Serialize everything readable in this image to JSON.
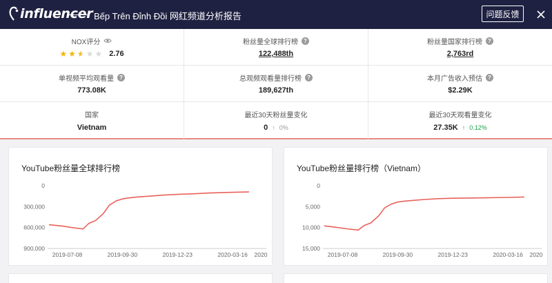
{
  "header": {
    "logo_text": "influencer",
    "title": "Bếp Trên Đỉnh Đồi 网红频道分析报告",
    "feedback_label": "问题反馈"
  },
  "stats": [
    [
      {
        "label": "NOX评分",
        "value": "2.76",
        "stars": 2.5,
        "icon": "eye-icon"
      },
      {
        "label": "粉丝量全球排行榜",
        "value": "122,488th",
        "link": true,
        "icon": "question-icon"
      },
      {
        "label": "粉丝量国家排行榜",
        "value": "2,763rd",
        "link": true,
        "icon": "question-icon"
      }
    ],
    [
      {
        "label": "单视频平均观看量",
        "value": "773.08K",
        "icon": "question-icon"
      },
      {
        "label": "总观频观看量排行榜",
        "value": "189,627th",
        "icon": "question-icon"
      },
      {
        "label": "本月广告收入预估",
        "value": "$2.29K",
        "icon": "question-icon"
      }
    ],
    [
      {
        "label": "国家",
        "value": "Vietnam"
      },
      {
        "label": "最近30天粉丝量变化",
        "value": "0",
        "arrow": "↑",
        "delta": "0%",
        "trend": "zero"
      },
      {
        "label": "最近30天观看量变化",
        "value": "27.35K",
        "arrow": "↑",
        "delta": "0.12%",
        "trend": "up"
      }
    ]
  ],
  "chart_data": [
    {
      "type": "line",
      "title": "YouTube粉丝量全球排行榜",
      "xlabel": "",
      "ylabel": "",
      "inverted_y": true,
      "ylim": [
        0,
        900000
      ],
      "yticks": [
        "0",
        "300,000",
        "600,000",
        "900,000"
      ],
      "xticks": [
        "2019-07-08",
        "2019-09-30",
        "2019-12-23",
        "2020-03-16",
        "2020"
      ],
      "line_color": "#e8625a",
      "series": [
        {
          "x": [
            "2019-06-10",
            "2019-07-01",
            "2019-07-15",
            "2019-08-01",
            "2019-08-10",
            "2019-08-20",
            "2019-09-01",
            "2019-09-10",
            "2019-09-20",
            "2019-09-30",
            "2019-10-10",
            "2019-10-25",
            "2019-11-10",
            "2019-12-01",
            "2019-12-23",
            "2020-01-15",
            "2020-02-10",
            "2020-03-16",
            "2020-04-10"
          ],
          "values": [
            560000,
            580000,
            600000,
            620000,
            540000,
            500000,
            400000,
            280000,
            220000,
            190000,
            175000,
            160000,
            150000,
            135000,
            125000,
            117000,
            105000,
            95000,
            90000
          ]
        }
      ]
    },
    {
      "type": "line",
      "title": "YouTube粉丝量排行榜（Vietnam）",
      "xlabel": "",
      "ylabel": "",
      "inverted_y": true,
      "ylim": [
        0,
        15000
      ],
      "yticks": [
        "0",
        "5,000",
        "10,000",
        "15,000"
      ],
      "xticks": [
        "2019-07-08",
        "2019-09-30",
        "2019-12-23",
        "2020-03-16",
        "2020"
      ],
      "line_color": "#e8625a",
      "series": [
        {
          "x": [
            "2019-06-10",
            "2019-07-01",
            "2019-07-15",
            "2019-08-01",
            "2019-08-10",
            "2019-08-20",
            "2019-09-01",
            "2019-09-10",
            "2019-09-20",
            "2019-09-30",
            "2019-10-10",
            "2019-10-25",
            "2019-11-10",
            "2019-12-01",
            "2019-12-23",
            "2020-01-15",
            "2020-02-10",
            "2020-03-16",
            "2020-04-10"
          ],
          "values": [
            9600,
            10000,
            10300,
            10600,
            9500,
            8900,
            7200,
            5300,
            4400,
            3900,
            3700,
            3500,
            3300,
            3100,
            3000,
            2950,
            2900,
            2800,
            2700
          ]
        }
      ]
    }
  ]
}
